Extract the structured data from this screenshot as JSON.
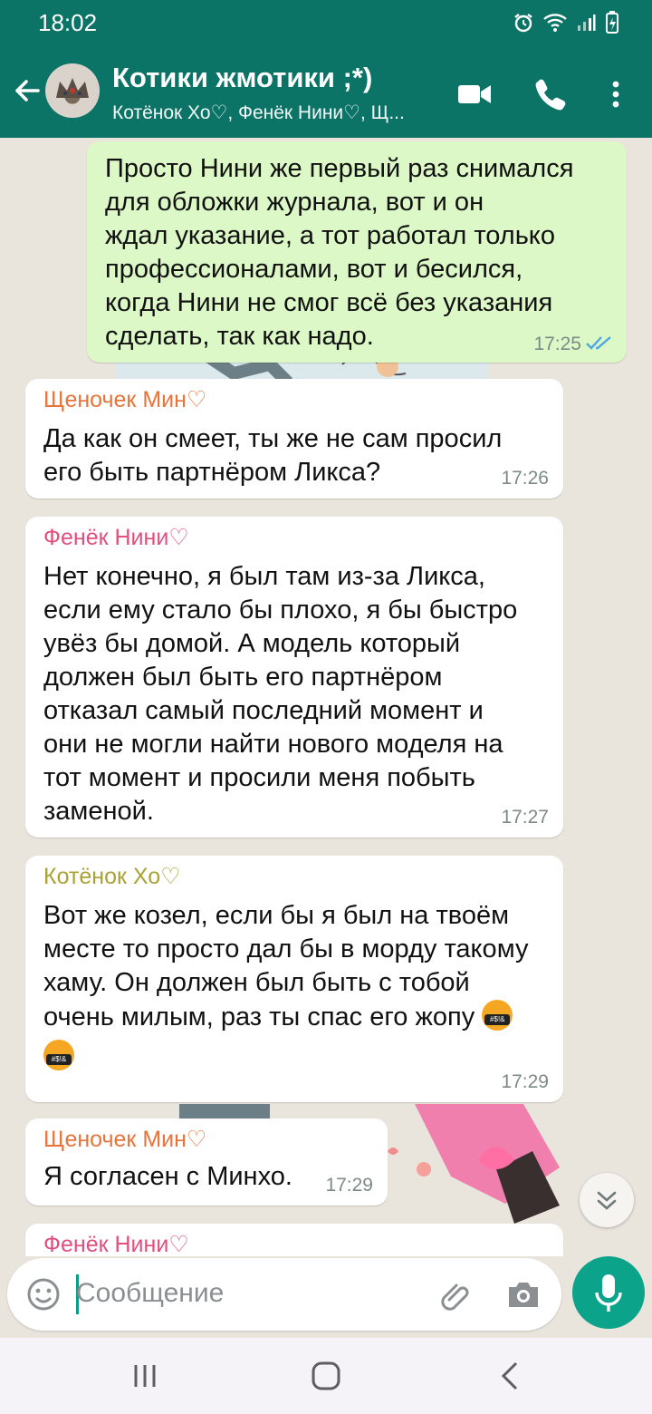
{
  "status": {
    "time": "18:02"
  },
  "header": {
    "title": "Котики жмотики ;*)",
    "subtitle": "Котёнок Хо♡, Фенёк Нини♡, Щ..."
  },
  "messages": [
    {
      "text": "Просто Нини же первый раз снимался\nдля обложки журнала, вот и он\nждал указание, а тот работал только\nпрофессионалами, вот и бесился,\nкогда Нини не смог всё без указания\nсделать, так как надо.",
      "time": "17:25"
    },
    {
      "sender": "Щеночек Мин♡",
      "text": "Да как он смеет, ты же не сам просил\nего быть партнёром Ликса?",
      "time": "17:26"
    },
    {
      "sender": "Фенёк Нини♡",
      "text": "Нет конечно,  я был там из-за Ликса,\nесли ему стало бы плохо, я бы быстро\nувёз бы домой. А модель который\nдолжен был быть его партнёром\nотказал самый последний момент и\nони не могли найти нового моделя на\nтот момент и просили меня побыть\nзаменой.",
      "time": "17:27"
    },
    {
      "sender": "Котёнок Хо♡",
      "text_line1": "Вот же козел, если бы я был на твоём",
      "text_line2": "месте то просто дал бы в морду такому",
      "text_line3": "хаму. Он должен был быть с тобой",
      "text_line4": "очень милым, раз ты спас его жопу",
      "time": "17:29"
    },
    {
      "sender": "Щеночек Мин♡",
      "text": "Я согласен с Минхо.",
      "time": "17:29"
    },
    {
      "sender": "Фенёк Нини♡"
    }
  ],
  "composer": {
    "placeholder": "Сообщение"
  },
  "colors": {
    "header": "#0b7466",
    "outgoing_bubble": "#dcf8c6",
    "sender_min": "#e8743b",
    "sender_nini": "#e0507e",
    "sender_ho": "#a9a336",
    "accent": "#0ba38a"
  },
  "icons": [
    "back-arrow-icon",
    "video-call-icon",
    "phone-icon",
    "more-vert-icon",
    "emoji-icon",
    "attach-icon",
    "camera-icon",
    "mic-icon",
    "scroll-down-icon",
    "double-check-icon"
  ]
}
